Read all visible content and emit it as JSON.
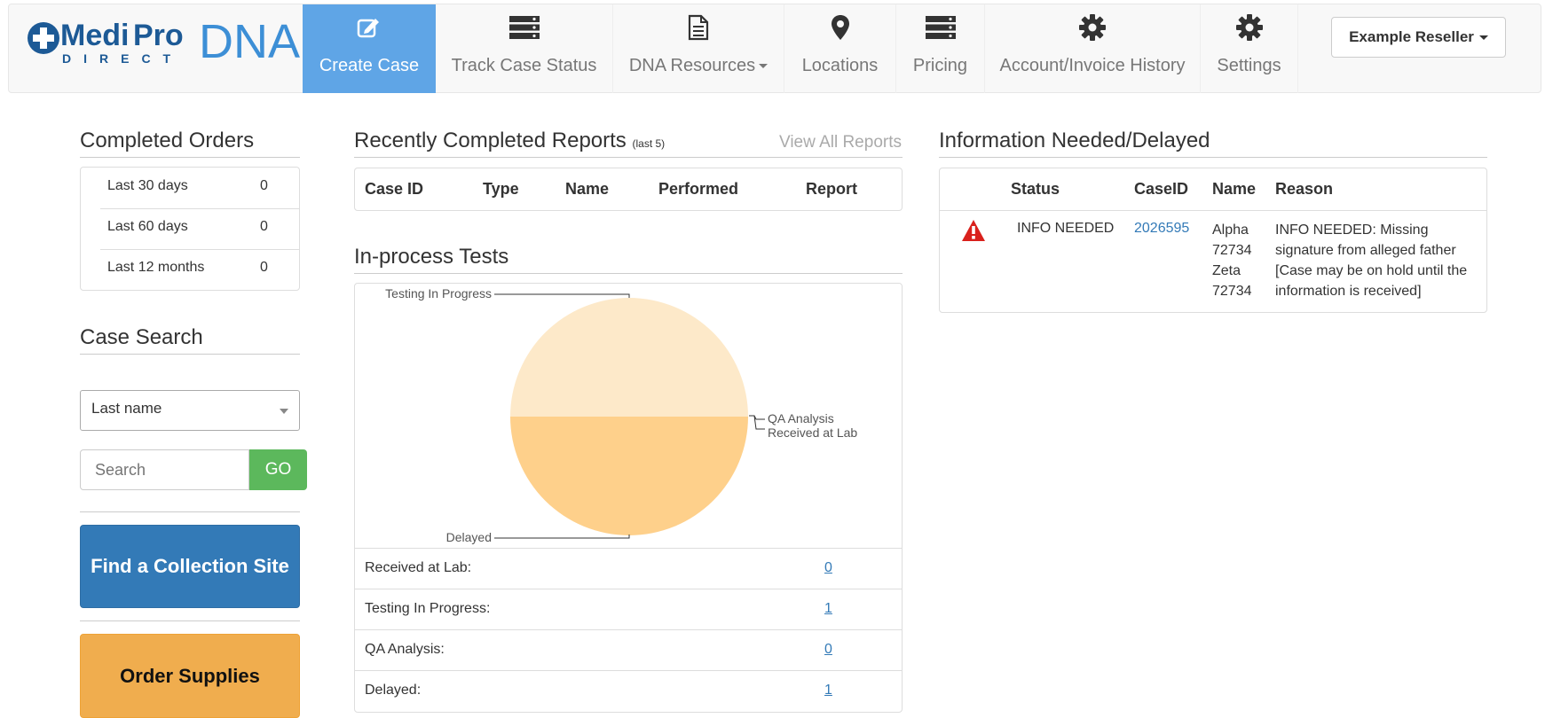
{
  "logo": {
    "brand_medi": "Medi",
    "brand_pro": "Pro",
    "brand_direct": "DIRECT",
    "brand_dna": "DNA"
  },
  "nav": {
    "items": [
      {
        "label": "Create Case",
        "icon": "edit-icon",
        "active": true
      },
      {
        "label": "Track Case Status",
        "icon": "server-icon"
      },
      {
        "label": "DNA Resources",
        "icon": "file-icon",
        "dropdown": true
      },
      {
        "label": "Locations",
        "icon": "map-marker-icon"
      },
      {
        "label": "Pricing",
        "icon": "server-icon"
      },
      {
        "label": "Account/Invoice History",
        "icon": "gear-icon"
      },
      {
        "label": "Settings",
        "icon": "gear-icon"
      }
    ],
    "reseller": "Example Reseller"
  },
  "completed_orders": {
    "title": "Completed Orders",
    "rows": [
      {
        "label": "Last 30 days",
        "value": "0"
      },
      {
        "label": "Last 60 days",
        "value": "0"
      },
      {
        "label": "Last 12 months",
        "value": "0"
      }
    ]
  },
  "case_search": {
    "title": "Case Search",
    "select_value": "Last name",
    "search_placeholder": "Search",
    "go_label": "GO"
  },
  "buttons": {
    "find_site": "Find a Collection Site",
    "order_supplies": "Order Supplies"
  },
  "recent_reports": {
    "title": "Recently Completed Reports",
    "subtitle": "(last 5)",
    "view_all": "View All Reports",
    "columns": [
      "Case ID",
      "Type",
      "Name",
      "Performed",
      "Report"
    ]
  },
  "in_process": {
    "title": "In-process Tests",
    "rows": [
      {
        "label": "Received at Lab:",
        "count": "0"
      },
      {
        "label": "Testing In Progress:",
        "count": "1"
      },
      {
        "label": "QA Analysis:",
        "count": "0"
      },
      {
        "label": "Delayed:",
        "count": "1"
      }
    ]
  },
  "chart_data": {
    "type": "pie",
    "title": "",
    "slices": [
      {
        "label": "Testing In Progress",
        "value": 1,
        "color": "#fde9c9"
      },
      {
        "label": "Delayed",
        "value": 1,
        "color": "#fed08b"
      },
      {
        "label": "QA Analysis",
        "value": 0
      },
      {
        "label": "Received at Lab",
        "value": 0
      }
    ]
  },
  "info_needed": {
    "title": "Information Needed/Delayed",
    "columns": [
      "Status",
      "CaseID",
      "Name",
      "Reason"
    ],
    "rows": [
      {
        "icon": "warning-icon",
        "status": "INFO NEEDED",
        "case_id": "2026595",
        "name_lines": [
          "Alpha",
          "72734",
          "Zeta",
          "72734"
        ],
        "reason_lines": [
          "INFO NEEDED: Missing",
          "signature from alleged father",
          "[Case may be on hold until the",
          "information is received]"
        ]
      }
    ]
  },
  "colors": {
    "active_nav": "#5fa5e6",
    "go_green": "#5cb85c",
    "primary_blue": "#337ab7",
    "warning_orange": "#f0ad4e",
    "alert_red": "#d9211c"
  }
}
